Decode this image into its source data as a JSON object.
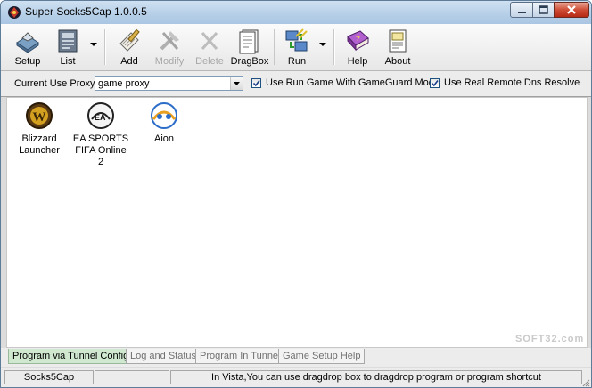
{
  "window": {
    "title": "Super Socks5Cap 1.0.0.5"
  },
  "toolbar": {
    "setup": "Setup",
    "list": "List",
    "add": "Add",
    "modify": "Modify",
    "delete": "Delete",
    "dragbox": "DragBox",
    "run": "Run",
    "help": "Help",
    "about": "About"
  },
  "proxy": {
    "label": "Current Use Proxy :",
    "value": "game proxy",
    "gameguard_label": "Use Run Game With GameGuard Mode",
    "gameguard_checked": true,
    "dns_label": "Use Real Remote Dns Resolve",
    "dns_checked": true
  },
  "programs": [
    {
      "line1": "Blizzard",
      "line2": "Launcher",
      "icon": "blizzard-launcher-icon"
    },
    {
      "line1": "EA SPORTS",
      "line2": "FIFA Online 2",
      "icon": "ea-sports-icon"
    },
    {
      "line1": "Aion",
      "line2": "",
      "icon": "aion-icon"
    }
  ],
  "watermark": "SOFT32.com",
  "tabs": [
    {
      "label": "Program via Tunnel Config",
      "active": true
    },
    {
      "label": "Log and Status",
      "active": false
    },
    {
      "label": "Program In Tunnel",
      "active": false
    },
    {
      "label": "Game Setup Help",
      "active": false
    }
  ],
  "status": {
    "app": "Socks5Cap",
    "middle": "",
    "message": "In Vista,You can use dragdrop box to dragdrop program or program shortcut"
  },
  "colors": {
    "active_tab": "#cfe8cf",
    "title_bar": "#b8d0e8",
    "close_button": "#cf4d35"
  }
}
